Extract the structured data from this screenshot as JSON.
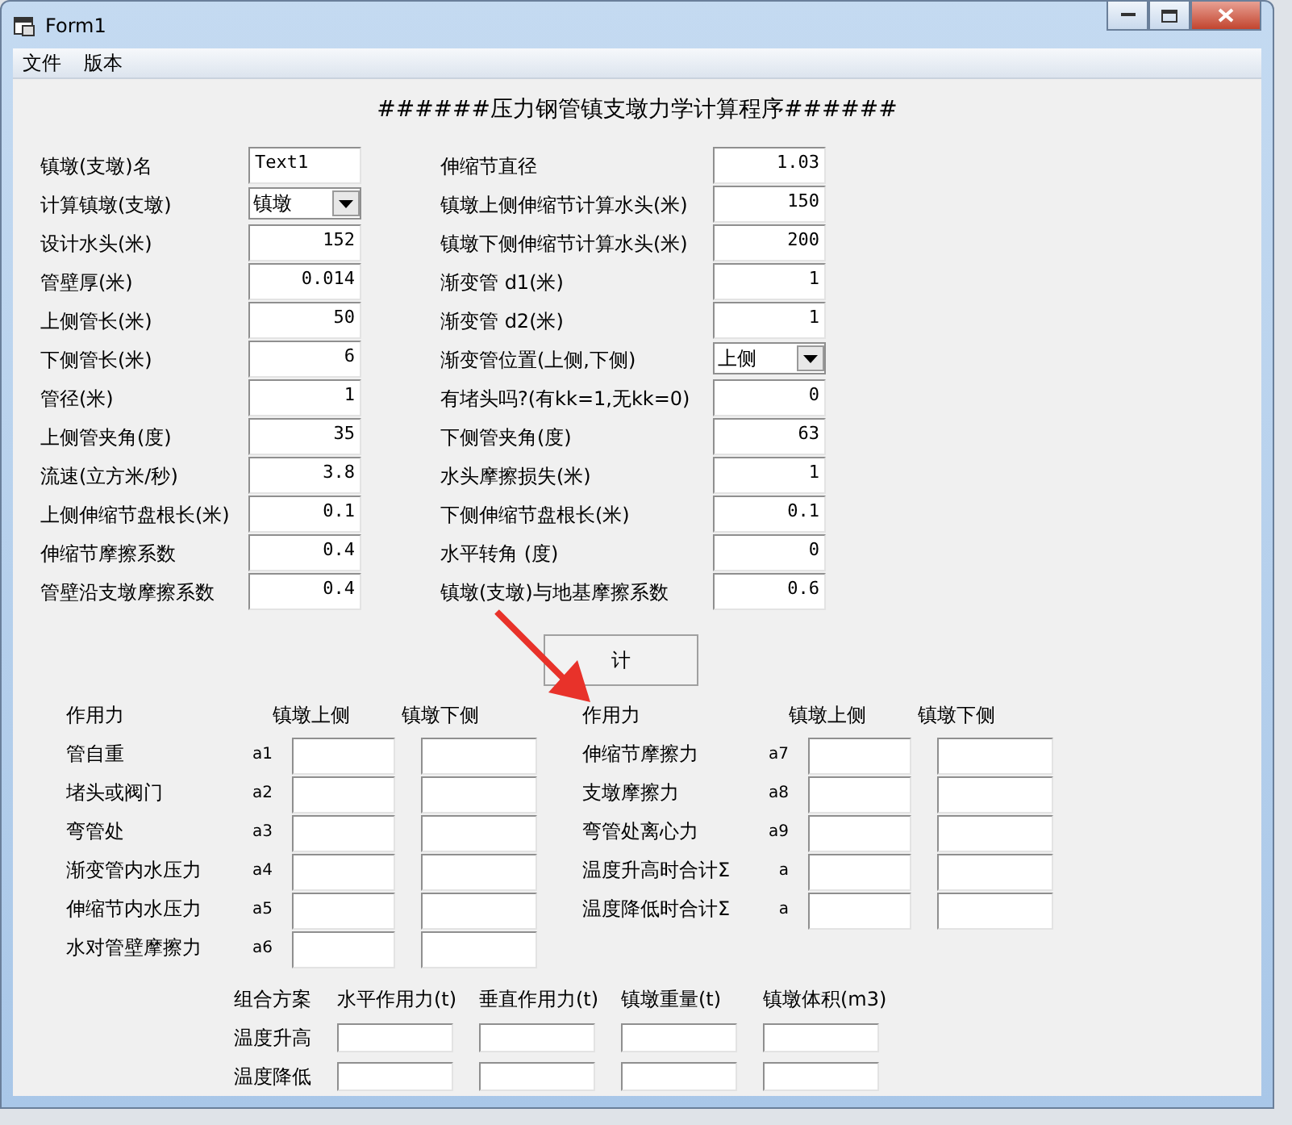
{
  "window": {
    "title": "Form1"
  },
  "menu": [
    "文件",
    "版本"
  ],
  "heading": "######压力钢管镇支墩力学计算程序######",
  "left_fields": [
    {
      "label": "镇墩(支墩)名",
      "kind": "name",
      "value": "Text1"
    },
    {
      "label": "计算镇墩(支墩)",
      "kind": "dropdown",
      "value": "镇墩"
    },
    {
      "label": "设计水头(米)",
      "kind": "text",
      "value": "152"
    },
    {
      "label": "管壁厚(米)",
      "kind": "text",
      "value": "0.014"
    },
    {
      "label": "上侧管长(米)",
      "kind": "text",
      "value": "50"
    },
    {
      "label": "下侧管长(米)",
      "kind": "text",
      "value": "6"
    },
    {
      "label": "管径(米)",
      "kind": "text",
      "value": "1"
    },
    {
      "label": "上侧管夹角(度)",
      "kind": "text",
      "value": "35"
    },
    {
      "label": "流速(立方米/秒)",
      "kind": "text",
      "value": "3.8"
    },
    {
      "label": "上侧伸缩节盘根长(米)",
      "kind": "text",
      "value": "0.1"
    },
    {
      "label": "伸缩节摩擦系数",
      "kind": "text",
      "value": "0.4"
    },
    {
      "label": "管壁沿支墩摩擦系数",
      "kind": "text",
      "value": "0.4"
    }
  ],
  "right_fields": [
    {
      "label": "伸缩节直径",
      "kind": "text",
      "value": "1.03"
    },
    {
      "label": "镇墩上侧伸缩节计算水头(米)",
      "kind": "text",
      "value": "150"
    },
    {
      "label": "镇墩下侧伸缩节计算水头(米)",
      "kind": "text",
      "value": "200"
    },
    {
      "label": "渐变管  d1(米)",
      "kind": "text",
      "value": "1"
    },
    {
      "label": "渐变管  d2(米)",
      "kind": "text",
      "value": "1"
    },
    {
      "label": "渐变管位置(上侧,下侧)",
      "kind": "dropdown",
      "value": "上侧"
    },
    {
      "label": "有堵头吗?(有kk=1,无kk=0)",
      "kind": "text",
      "value": "0"
    },
    {
      "label": "下侧管夹角(度)",
      "kind": "text",
      "value": "63"
    },
    {
      "label": "水头摩擦损失(米)",
      "kind": "text",
      "value": "1"
    },
    {
      "label": "下侧伸缩节盘根长(米)",
      "kind": "text",
      "value": "0.1"
    },
    {
      "label": "水平转角 (度)",
      "kind": "text",
      "value": "0"
    },
    {
      "label": "镇墩(支墩)与地基摩擦系数",
      "kind": "text",
      "value": "0.6"
    }
  ],
  "calc_button": "计",
  "force_tables": [
    {
      "headers": [
        "作用力",
        "镇墩上侧",
        "镇墩下侧"
      ],
      "rows": [
        {
          "label": "管自重",
          "sub": "a1"
        },
        {
          "label": "堵头或阀门",
          "sub": "a2"
        },
        {
          "label": "弯管处",
          "sub": "a3"
        },
        {
          "label": "渐变管内水压力",
          "sub": "a4"
        },
        {
          "label": "伸缩节内水压力",
          "sub": "a5"
        },
        {
          "label": "水对管壁摩擦力",
          "sub": "a6"
        }
      ]
    },
    {
      "headers": [
        "作用力",
        "镇墩上侧",
        "镇墩下侧"
      ],
      "rows": [
        {
          "label": "伸缩节摩擦力",
          "sub": "a7"
        },
        {
          "label": "支墩摩擦力",
          "sub": "a8"
        },
        {
          "label": "弯管处离心力",
          "sub": "a9"
        },
        {
          "label": "温度升高时合计Σ",
          "sub": "a"
        },
        {
          "label": "温度降低时合计Σ",
          "sub": "a"
        }
      ]
    }
  ],
  "combination": {
    "headers": [
      "组合方案",
      "水平作用力(t)",
      "垂直作用力(t)",
      "镇墩重量(t)",
      "镇墩体积(m3)"
    ],
    "rows": [
      "温度升高",
      "温度降低"
    ]
  }
}
